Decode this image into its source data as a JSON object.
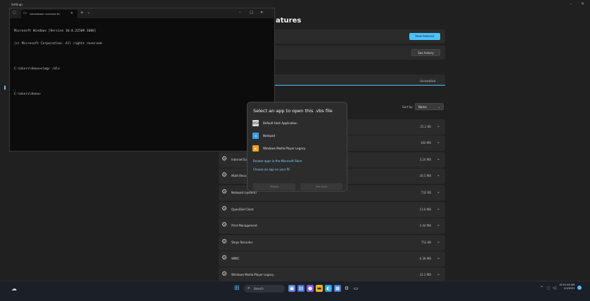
{
  "settings": {
    "window_title": "Settings",
    "page_title": "atures",
    "view_features_label": "View features",
    "see_history_label": "See history",
    "search_value": "Uninstalled",
    "sort_label": "Sort by:",
    "sort_value": "Name",
    "features": [
      {
        "name": "",
        "size": "25.2 KB"
      },
      {
        "name": "",
        "size": "160 MB"
      },
      {
        "name": "Internet Ex",
        "size": "3.24 MB"
      },
      {
        "name": "Math Reco",
        "size": "30.5 MB"
      },
      {
        "name": "Notepad (system)",
        "size": "732 KB"
      },
      {
        "name": "OpenSSH Client",
        "size": "13.6 MB"
      },
      {
        "name": "Print Management",
        "size": "2.44 MB"
      },
      {
        "name": "Steps Recorder",
        "size": "752 KB"
      },
      {
        "name": "WMIC",
        "size": "6.38 MB"
      },
      {
        "name": "Windows Media Player Legacy",
        "size": "32.2 MB"
      }
    ]
  },
  "terminal": {
    "tab_title": "Administrator: Command Pro",
    "lines": [
      "Microsoft Windows [Version 10.0.22509.1000]",
      "(c) Microsoft Corporation. All rights reserved.",
      "",
      "C:\\Users\\Xeno>slmgr /dlv",
      "",
      "C:\\Users\\Xeno>"
    ]
  },
  "dialog": {
    "title": "Select an app to open this .vbs file",
    "apps": [
      {
        "label": "Default Host Application",
        "icon": "wsh-icon",
        "color": "#c8c8c8"
      },
      {
        "label": "Notepad",
        "icon": "notepad-icon",
        "color": "#3aa0e8"
      },
      {
        "label": "Windows Media Player Legacy",
        "icon": "media-player-icon",
        "color": "#f0a020"
      }
    ],
    "store_link": "Browse apps in the Microsoft Store",
    "pc_link": "Choose an app on your PC",
    "always_label": "Always",
    "just_once_label": "Just once"
  },
  "taskbar": {
    "search_label": "Search",
    "time": "10:51:49 AM",
    "date": "1/1/2021",
    "accent": "#4cc2ff"
  }
}
